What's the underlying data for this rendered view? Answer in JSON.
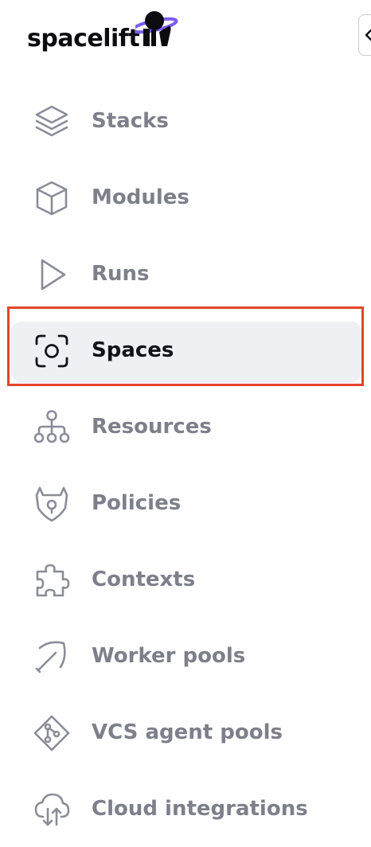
{
  "app": {
    "logo_text": "spacelift"
  },
  "colors": {
    "accent": "#7b5cf0",
    "text_muted": "#7d7f8a",
    "text_active": "#111218",
    "active_bg": "#eef0f4",
    "highlight": "#e2452b"
  },
  "sidebar": {
    "collapse_icon": "chevron-left-icon",
    "items": [
      {
        "label": "Stacks",
        "icon": "layers-icon",
        "active": false
      },
      {
        "label": "Modules",
        "icon": "cube-icon",
        "active": false
      },
      {
        "label": "Runs",
        "icon": "play-icon",
        "active": false
      },
      {
        "label": "Spaces",
        "icon": "spaces-icon",
        "active": true
      },
      {
        "label": "Resources",
        "icon": "tree-icon",
        "active": false
      },
      {
        "label": "Policies",
        "icon": "shield-icon",
        "active": false
      },
      {
        "label": "Contexts",
        "icon": "puzzle-icon",
        "active": false
      },
      {
        "label": "Worker pools",
        "icon": "pickaxe-icon",
        "active": false
      },
      {
        "label": "VCS agent pools",
        "icon": "git-diamond-icon",
        "active": false
      },
      {
        "label": "Cloud integrations",
        "icon": "cloud-icon",
        "active": false
      }
    ]
  }
}
